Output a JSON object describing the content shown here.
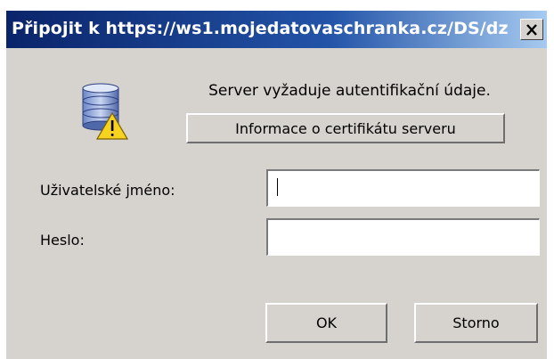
{
  "window": {
    "title": "Připojit k https://ws1.mojedatovaschranka.cz/DS/dz",
    "close_icon": "close-icon"
  },
  "message": {
    "icon": "server-warning-icon",
    "text": "Server vyžaduje autentifikační údaje."
  },
  "cert_button": {
    "label": "Informace o certifikátu serveru"
  },
  "form": {
    "username_label": "Uživatelské jméno:",
    "username_value": "",
    "password_label": "Heslo:",
    "password_value": ""
  },
  "buttons": {
    "ok": "OK",
    "cancel": "Storno"
  }
}
